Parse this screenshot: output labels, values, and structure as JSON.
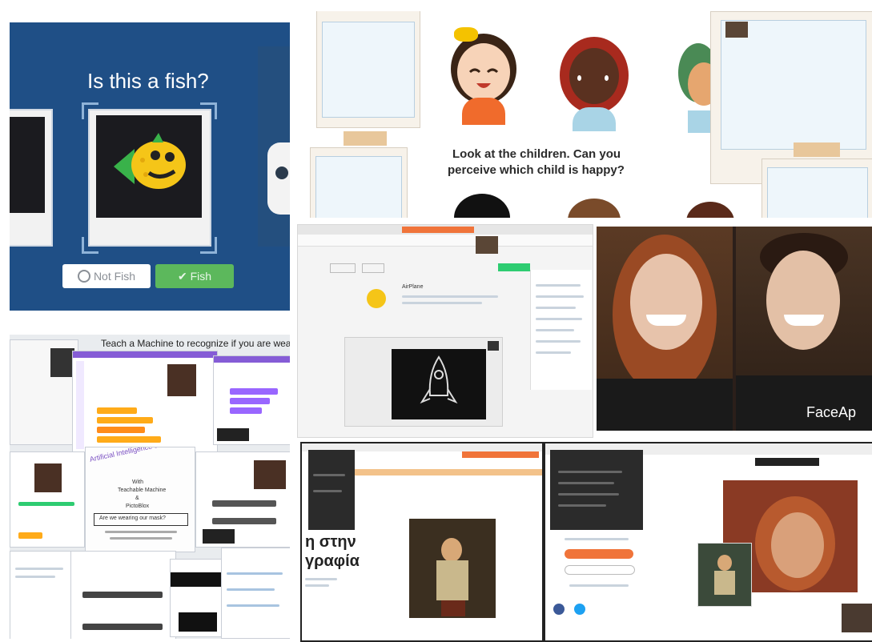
{
  "fish_game": {
    "question": "Is this a fish?",
    "not_fish_label": "Not Fish",
    "fish_label": "Fish"
  },
  "children_activity": {
    "prompt_line1": "Look at the children. Can you",
    "prompt_line2": "perceive which child is happy?"
  },
  "scratch_collage": {
    "banner": "Teach a Machine to recognize if you are wea",
    "slide_title": "Artificial Intelligence & Machine Learning",
    "slide_sub1": "With",
    "slide_sub2": "Teachable Machine",
    "slide_sub3": "&",
    "slide_sub4": "PictoBlox",
    "slide_caption": "Are we wearing our mask?"
  },
  "share_window": {
    "project_title": "AirPlane"
  },
  "faceapp": {
    "watermark": "FaceAp"
  },
  "greek_slide": {
    "line1": "η στην",
    "line2": "γραφία"
  },
  "colors": {
    "fish_bg": "#1f4f86",
    "fish_green": "#5cb85c",
    "orange_accent": "#f0743a"
  }
}
